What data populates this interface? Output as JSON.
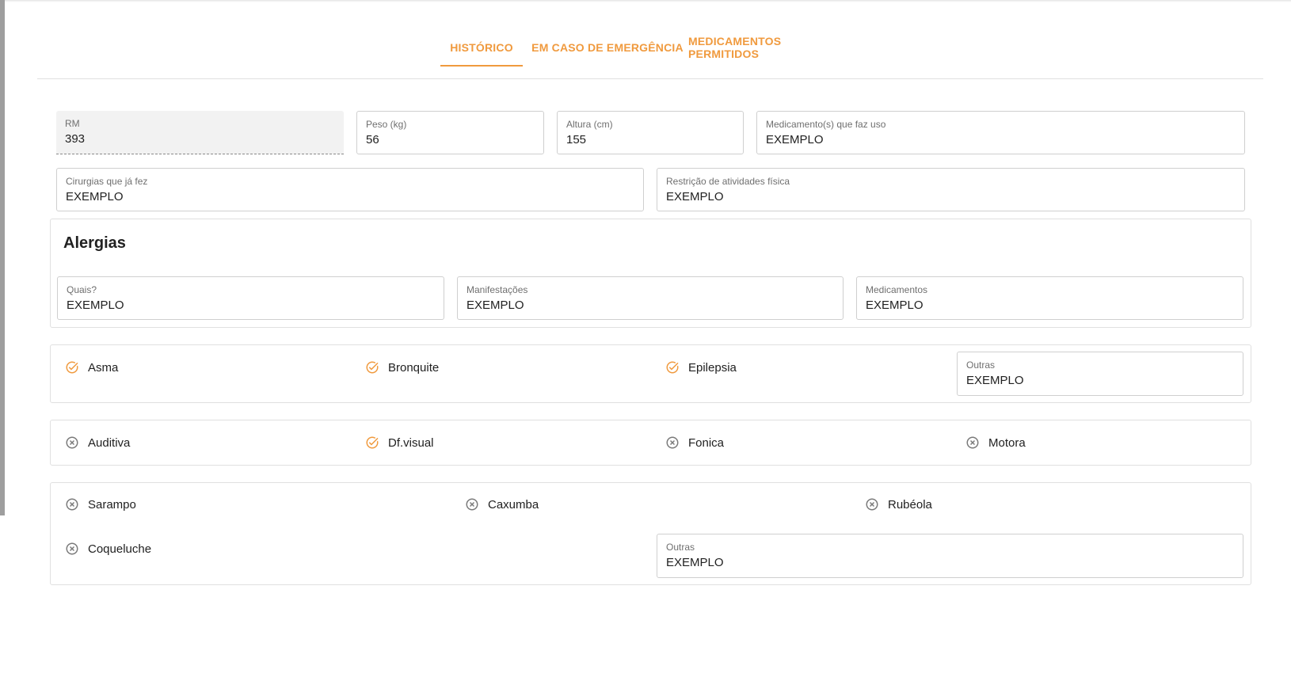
{
  "tabs": [
    {
      "label": "HISTÓRICO",
      "active": true
    },
    {
      "label": "EM CASO DE EMERGÊNCIA",
      "active": false
    },
    {
      "label": "MEDICAMENTOS PERMITIDOS",
      "active": false
    }
  ],
  "fields": {
    "rm": {
      "label": "RM",
      "value": "393"
    },
    "peso": {
      "label": "Peso (kg)",
      "value": "56"
    },
    "altura": {
      "label": "Altura (cm)",
      "value": "155"
    },
    "medicamentos_uso": {
      "label": "Medicamento(s) que faz uso",
      "value": "EXEMPLO"
    },
    "cirurgias": {
      "label": "Cirurgias que já fez",
      "value": "EXEMPLO"
    },
    "restricao": {
      "label": "Restrição de atividades física",
      "value": "EXEMPLO"
    }
  },
  "alergias": {
    "title": "Alergias",
    "quais": {
      "label": "Quais?",
      "value": "EXEMPLO"
    },
    "manifestacoes": {
      "label": "Manifestações",
      "value": "EXEMPLO"
    },
    "medicamentos": {
      "label": "Medicamentos",
      "value": "EXEMPLO"
    }
  },
  "doencas_respiratorias": {
    "items": [
      {
        "label": "Asma",
        "checked": true
      },
      {
        "label": "Bronquite",
        "checked": true
      },
      {
        "label": "Epilepsia",
        "checked": true
      }
    ],
    "outras": {
      "label": "Outras",
      "value": "EXEMPLO"
    }
  },
  "deficiencias": {
    "items": [
      {
        "label": "Auditiva",
        "checked": false
      },
      {
        "label": "Df.visual",
        "checked": true
      },
      {
        "label": "Fonica",
        "checked": false
      },
      {
        "label": "Motora",
        "checked": false
      }
    ]
  },
  "doencas_infantis": {
    "items": [
      {
        "label": "Sarampo",
        "checked": false
      },
      {
        "label": "Caxumba",
        "checked": false
      },
      {
        "label": "Rubéola",
        "checked": false
      },
      {
        "label": "Coqueluche",
        "checked": false
      }
    ],
    "outras": {
      "label": "Outras",
      "value": "EXEMPLO"
    }
  },
  "colors": {
    "accent": "#f09a3e",
    "unchecked": "#7a7a7a"
  },
  "icons": {
    "checked": "check-circle-icon",
    "unchecked": "cancel-circle-icon"
  }
}
